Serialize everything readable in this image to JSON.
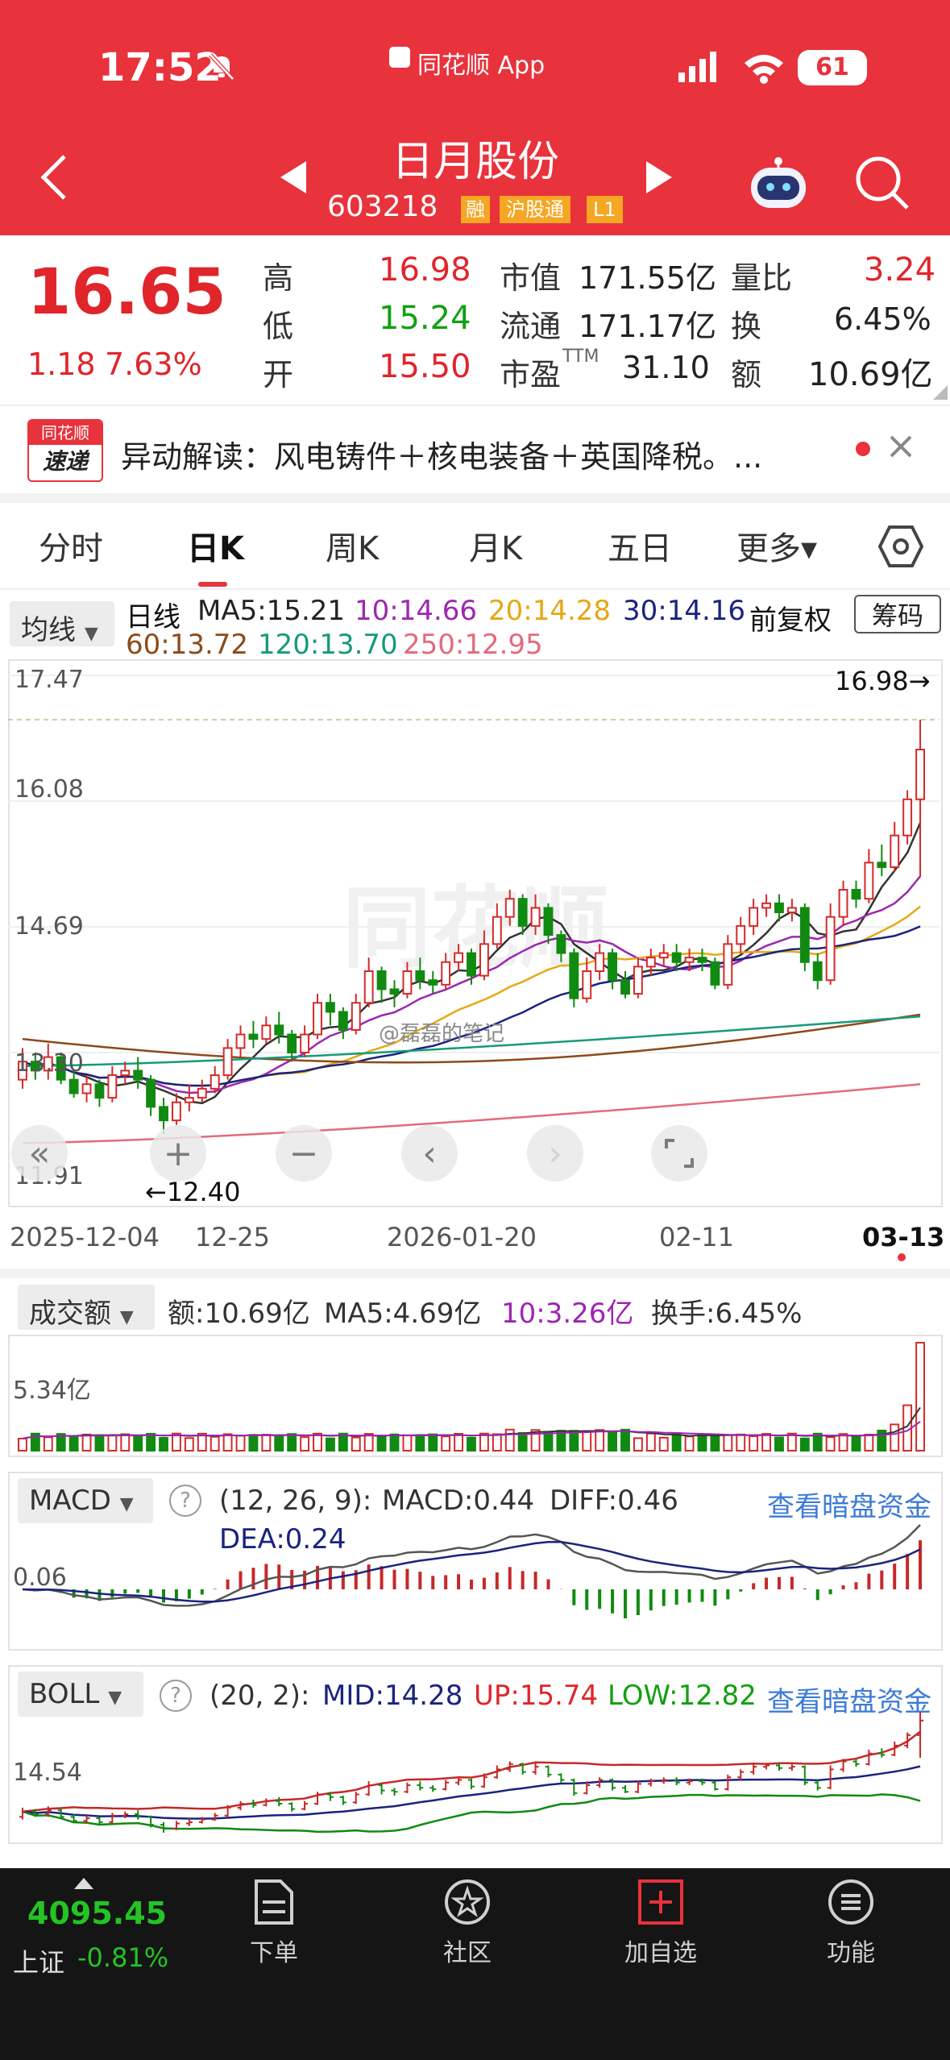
{
  "status_bar": {
    "time": "17:52",
    "app": "同花顺 App",
    "battery": "61"
  },
  "header": {
    "title": "日月股份",
    "code": "603218",
    "badges": [
      "融",
      "沪股通",
      "L1"
    ]
  },
  "quote": {
    "price": "16.65",
    "change": "1.18",
    "change_pct": "7.63%",
    "rows": [
      [
        {
          "label": "高",
          "value": "16.98"
        },
        {
          "label": "市值",
          "value": "171.55亿"
        },
        {
          "label": "量比",
          "value": "3.24"
        }
      ],
      [
        {
          "label": "低",
          "value": "15.24"
        },
        {
          "label": "流通",
          "value": "171.17亿"
        },
        {
          "label": "换",
          "value": "6.45%"
        }
      ],
      [
        {
          "label": "开",
          "value": "15.50"
        },
        {
          "label": "市盈",
          "sup": "TTM",
          "value": "31.10"
        },
        {
          "label": "额",
          "value": "10.69亿"
        }
      ]
    ]
  },
  "news": {
    "logo_top": "同花顺",
    "logo_bottom": "速递",
    "text": "异动解读：风电铸件＋核电装备＋英国降税。..."
  },
  "tabs": [
    "分时",
    "日K",
    "周K",
    "月K",
    "五日",
    "更多",
    "更多▾"
  ],
  "active_tab": "日K",
  "ma_legend": {
    "dropdown": "均线",
    "kind": "日线",
    "items": [
      {
        "label": "MA5:15.21",
        "color": "#333333"
      },
      {
        "label": "10:14.66",
        "color": "#9c27b0"
      },
      {
        "label": "20:14.28",
        "color": "#e6a817"
      },
      {
        "label": "30:14.16",
        "color": "#1a237e"
      },
      {
        "label": "60:13.72",
        "color": "#8d4a1a"
      },
      {
        "label": "120:13.70",
        "color": "#169a7a"
      },
      {
        "label": "250:12.95",
        "color": "#e36a7c"
      }
    ],
    "adjust": "前复权",
    "chip_button": "筹码"
  },
  "main_chart": {
    "y_ticks": [
      "17.47",
      "16.08",
      "14.69",
      "13.30",
      "11.91"
    ],
    "high_label": "16.98→",
    "low_label": "←12.40",
    "dates": [
      "2025-12-04",
      "12-25",
      "2026-01-20",
      "02-11",
      "03-13"
    ],
    "watermark": "同花顺",
    "weibo": "@磊磊的笔记"
  },
  "volume": {
    "dropdown": "成交额",
    "amount": "额:10.69亿",
    "ma5": "MA5:4.69亿",
    "ma10": "10:3.26亿",
    "turnover": "换手:6.45%",
    "y_tick": "5.34亿"
  },
  "macd": {
    "dropdown": "MACD",
    "params": "(12, 26, 9):",
    "macd": "MACD:0.44",
    "diff": "DIFF:0.46",
    "dea": "DEA:0.24",
    "link": "查看暗盘资金",
    "y_tick": "0.06"
  },
  "boll": {
    "dropdown": "BOLL",
    "params": "(20, 2):",
    "mid": "MID:14.28",
    "up": "UP:15.74",
    "low": "LOW:12.82",
    "link": "查看暗盘资金",
    "y_tick": "14.54"
  },
  "bottom_nav": {
    "index_value": "4095.45",
    "index_name": "上证",
    "index_change": "-0.81%",
    "items": [
      {
        "label": "下单",
        "icon": "order-icon"
      },
      {
        "label": "社区",
        "icon": "community-icon"
      },
      {
        "label": "加自选",
        "icon": "add-watchlist-icon"
      },
      {
        "label": "功能",
        "icon": "menu-icon"
      }
    ]
  },
  "colors": {
    "header_red": "#e8323c",
    "up_red": "#e0252b",
    "down_green": "#12a012",
    "link_blue": "#3d7bd6"
  },
  "chart_data": {
    "type": "candlestick",
    "y_range": [
      11.91,
      17.47
    ],
    "high_marker": 16.98,
    "low_marker": 12.4,
    "ma": {
      "MA5": 15.21,
      "MA10": 14.66,
      "MA20": 14.28,
      "MA30": 14.16,
      "MA60": 13.72,
      "MA120": 13.7,
      "MA250": 12.95
    },
    "candles": [
      [
        13.0,
        13.2,
        13.35,
        12.9
      ],
      [
        13.2,
        13.1,
        13.3,
        13.0
      ],
      [
        13.1,
        13.25,
        13.4,
        13.0
      ],
      [
        13.25,
        13.0,
        13.3,
        12.95
      ],
      [
        13.0,
        12.85,
        13.1,
        12.8
      ],
      [
        12.85,
        12.95,
        13.05,
        12.75
      ],
      [
        12.95,
        12.8,
        13.0,
        12.7
      ],
      [
        12.8,
        13.05,
        13.15,
        12.75
      ],
      [
        13.05,
        13.1,
        13.2,
        12.95
      ],
      [
        13.1,
        13.0,
        13.25,
        12.9
      ],
      [
        13.0,
        12.7,
        13.05,
        12.6
      ],
      [
        12.7,
        12.55,
        12.8,
        12.4
      ],
      [
        12.55,
        12.75,
        12.85,
        12.5
      ],
      [
        12.75,
        12.8,
        12.95,
        12.65
      ],
      [
        12.8,
        12.9,
        13.0,
        12.75
      ],
      [
        12.9,
        13.05,
        13.15,
        12.85
      ],
      [
        13.05,
        13.35,
        13.45,
        13.0
      ],
      [
        13.35,
        13.5,
        13.6,
        13.25
      ],
      [
        13.5,
        13.45,
        13.65,
        13.35
      ],
      [
        13.45,
        13.6,
        13.7,
        13.4
      ],
      [
        13.6,
        13.5,
        13.75,
        13.4
      ],
      [
        13.5,
        13.3,
        13.55,
        13.2
      ],
      [
        13.3,
        13.5,
        13.6,
        13.25
      ],
      [
        13.5,
        13.85,
        13.95,
        13.45
      ],
      [
        13.85,
        13.75,
        13.95,
        13.6
      ],
      [
        13.75,
        13.55,
        13.8,
        13.45
      ],
      [
        13.55,
        13.85,
        13.95,
        13.5
      ],
      [
        13.85,
        14.2,
        14.35,
        13.8
      ],
      [
        14.2,
        14.0,
        14.25,
        13.85
      ],
      [
        14.0,
        13.95,
        14.1,
        13.8
      ],
      [
        13.95,
        14.2,
        14.3,
        13.9
      ],
      [
        14.2,
        14.1,
        14.35,
        14.0
      ],
      [
        14.1,
        14.05,
        14.2,
        13.95
      ],
      [
        14.05,
        14.3,
        14.4,
        14.0
      ],
      [
        14.3,
        14.4,
        14.5,
        14.2
      ],
      [
        14.4,
        14.15,
        14.45,
        14.05
      ],
      [
        14.15,
        14.5,
        14.65,
        14.1
      ],
      [
        14.5,
        14.8,
        14.95,
        14.45
      ],
      [
        14.8,
        15.0,
        15.1,
        14.7
      ],
      [
        15.0,
        14.7,
        15.05,
        14.6
      ],
      [
        14.7,
        14.9,
        15.05,
        14.6
      ],
      [
        14.9,
        14.6,
        14.95,
        14.5
      ],
      [
        14.6,
        14.4,
        14.65,
        14.3
      ],
      [
        14.4,
        13.9,
        14.45,
        13.8
      ],
      [
        13.9,
        14.2,
        14.35,
        13.85
      ],
      [
        14.2,
        14.4,
        14.5,
        14.1
      ],
      [
        14.4,
        14.1,
        14.45,
        14.0
      ],
      [
        14.1,
        13.95,
        14.2,
        13.9
      ],
      [
        13.95,
        14.25,
        14.35,
        13.9
      ],
      [
        14.25,
        14.35,
        14.45,
        14.15
      ],
      [
        14.35,
        14.4,
        14.5,
        14.25
      ],
      [
        14.4,
        14.3,
        14.5,
        14.2
      ],
      [
        14.3,
        14.35,
        14.45,
        14.2
      ],
      [
        14.35,
        14.3,
        14.45,
        14.2
      ],
      [
        14.3,
        14.05,
        14.35,
        14.0
      ],
      [
        14.05,
        14.5,
        14.6,
        14.0
      ],
      [
        14.5,
        14.7,
        14.8,
        14.4
      ],
      [
        14.7,
        14.9,
        15.0,
        14.6
      ],
      [
        14.9,
        14.95,
        15.05,
        14.8
      ],
      [
        14.95,
        14.85,
        15.05,
        14.75
      ],
      [
        14.85,
        14.9,
        15.0,
        14.75
      ],
      [
        14.9,
        14.3,
        14.95,
        14.2
      ],
      [
        14.3,
        14.1,
        14.4,
        14.0
      ],
      [
        14.1,
        14.8,
        14.95,
        14.05
      ],
      [
        14.8,
        15.1,
        15.2,
        14.7
      ],
      [
        15.1,
        15.0,
        15.2,
        14.9
      ],
      [
        15.0,
        15.4,
        15.55,
        14.95
      ],
      [
        15.4,
        15.35,
        15.6,
        15.25
      ],
      [
        15.35,
        15.7,
        15.85,
        15.3
      ],
      [
        15.7,
        16.1,
        16.2,
        15.6
      ],
      [
        16.1,
        16.65,
        16.98,
        15.24
      ]
    ],
    "volume_peak": 10.69
  }
}
